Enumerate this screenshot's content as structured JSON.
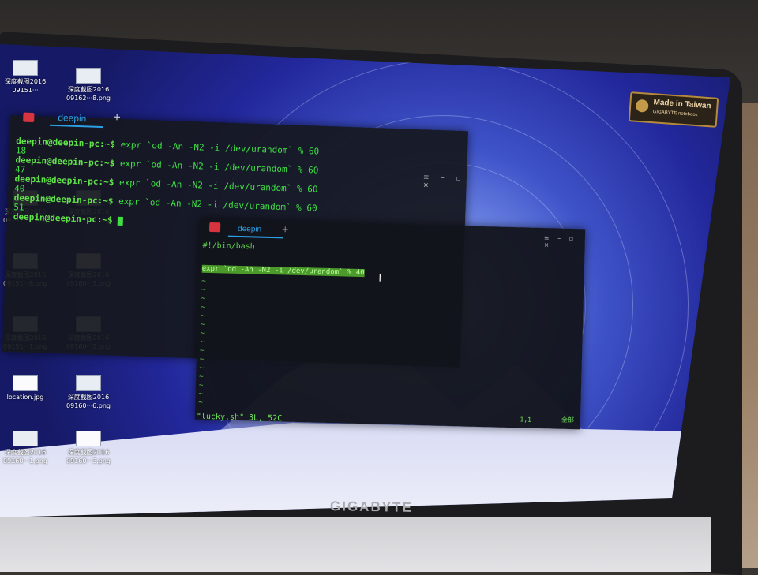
{
  "photo": {
    "brand_text": "GIGABYTE",
    "badge_line1": "Made in Taiwan",
    "badge_line2": "GIGABYTE notebook"
  },
  "desktop": {
    "icons": [
      {
        "label": "深度截图2016 09151···",
        "name": "desktop-file-1"
      },
      {
        "label": "深度截图2016 09162···8.png",
        "name": "desktop-file-2"
      },
      {
        "label": "深度截图2016 09151···6.png",
        "name": "desktop-file-3"
      },
      {
        "label": "深度截图2016 09162···2.png",
        "name": "desktop-file-4"
      },
      {
        "label": "深度截图2016 09151···8.png",
        "name": "desktop-file-5"
      },
      {
        "label": "深度截图2016 09160···3.png",
        "name": "desktop-file-6"
      },
      {
        "label": "深度截图2016 09151···1.png",
        "name": "desktop-file-7"
      },
      {
        "label": "深度截图2016 09160···2.png",
        "name": "desktop-file-8"
      },
      {
        "label": "location.jpg",
        "name": "desktop-file-9"
      },
      {
        "label": "深度截图2016 09160···6.png",
        "name": "desktop-file-10"
      },
      {
        "label": "深度截图2016 09160···1.png",
        "name": "desktop-file-11"
      },
      {
        "label": "深度截图2016 09160···3.png",
        "name": "desktop-file-12"
      }
    ]
  },
  "terminal_back": {
    "tab_label": "deepin",
    "plus": "+",
    "controls": "≡ – ▫ ×",
    "lines": [
      {
        "prompt": "deepin@deepin-pc:~$",
        "command": " expr `od -An -N2 -i /dev/urandom` % 60"
      },
      {
        "output": "18"
      },
      {
        "prompt": "deepin@deepin-pc:~$",
        "command": " expr `od -An -N2 -i /dev/urandom` % 60"
      },
      {
        "output": "47"
      },
      {
        "prompt": "deepin@deepin-pc:~$",
        "command": " expr `od -An -N2 -i /dev/urandom` % 60"
      },
      {
        "output": "40"
      },
      {
        "prompt": "deepin@deepin-pc:~$",
        "command": " expr `od -An -N2 -i /dev/urandom` % 60"
      },
      {
        "output": "51"
      },
      {
        "prompt": "deepin@deepin-pc:~$",
        "command": " "
      }
    ]
  },
  "terminal_front": {
    "tab_label": "deepin",
    "plus": "+",
    "controls": "≡ – ▫ ×",
    "shebang": "#!/bin/bash",
    "selected_line": "expr `od -An -N2 -i /dev/urandom` % 40",
    "tilde": "~",
    "status_file": "\"lucky.sh\" 3L, 52C",
    "status_pos": "1,1",
    "status_all": "全部",
    "cursor_glyph": "I"
  },
  "dock": {
    "items": [
      "launcher",
      "multitasking",
      "files",
      "store",
      "music",
      "video",
      "terminal",
      "settings",
      "wifi",
      "power",
      "clock",
      "calendar",
      "trash"
    ],
    "colors": [
      "#d7d9e6",
      "#9fd36b",
      "#7ec85a",
      "#e7b844",
      "#f2d14a",
      "#3fb6d8",
      "#d84d52",
      "#4da2e0",
      "#25c2ab",
      "#e8e0b8",
      "#f0ead0",
      "#f3f0e6",
      "#f4f2f0"
    ]
  }
}
